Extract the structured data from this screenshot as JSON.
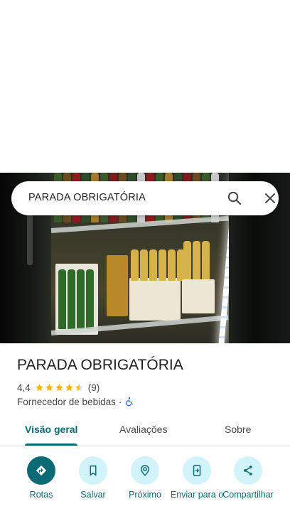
{
  "search": {
    "query": "PARADA OBRIGATÓRIA",
    "icons": [
      "search-icon",
      "close-icon"
    ]
  },
  "place": {
    "title": "PARADA OBRIGATÓRIA",
    "rating": "4,4",
    "rating_stars": 4.4,
    "review_count": "(9)",
    "category": "Fornecedor de bebidas",
    "separator": "·",
    "accessibility_icon": "wheelchair-icon"
  },
  "tabs": [
    {
      "label": "Visão geral",
      "active": true
    },
    {
      "label": "Avaliações",
      "active": false
    },
    {
      "label": "Sobre",
      "active": false
    }
  ],
  "actions": [
    {
      "label": "Rotas",
      "icon": "directions-icon"
    },
    {
      "label": "Salvar",
      "icon": "bookmark-icon"
    },
    {
      "label": "Próximo",
      "icon": "nearby-icon"
    },
    {
      "label": "Enviar para o",
      "icon": "send-to-phone-icon"
    },
    {
      "label": "Compartilhar",
      "icon": "share-icon"
    }
  ],
  "colors": {
    "accent": "#0b6a74",
    "button_bg": "#d3f3fb",
    "star": "#f4b400",
    "text": "#1f1f1f",
    "secondary_text": "#444746"
  }
}
